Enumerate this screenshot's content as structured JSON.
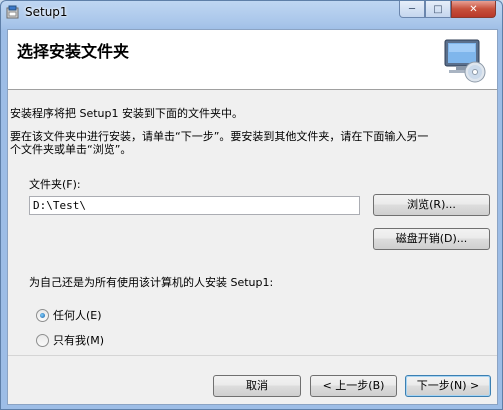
{
  "window": {
    "title": "Setup1",
    "caption_buttons": {
      "minimize": "─",
      "maximize": "□",
      "close": "✕"
    }
  },
  "header": {
    "title": "选择安装文件夹"
  },
  "body": {
    "intro": "安装程序将把 Setup1 安装到下面的文件夹中。",
    "instruction_line1": "要在该文件夹中进行安装，请单击“下一步”。要安装到其他文件夹，请在下面输入另一",
    "instruction_line2": "个文件夹或单击“浏览”。",
    "folder_label": "文件夹(F):",
    "folder_value": "D:\\Test\\",
    "browse_button": "浏览(R)...",
    "disk_cost_button": "磁盘开销(D)...",
    "install_for_question": "为自己还是为所有使用该计算机的人安装 Setup1:",
    "radio_options": [
      {
        "label": "任何人(E)",
        "selected": true
      },
      {
        "label": "只有我(M)",
        "selected": false
      }
    ]
  },
  "footer": {
    "cancel_button": "取消",
    "back_button": "< 上一步(B)",
    "next_button": "下一步(N) >"
  }
}
